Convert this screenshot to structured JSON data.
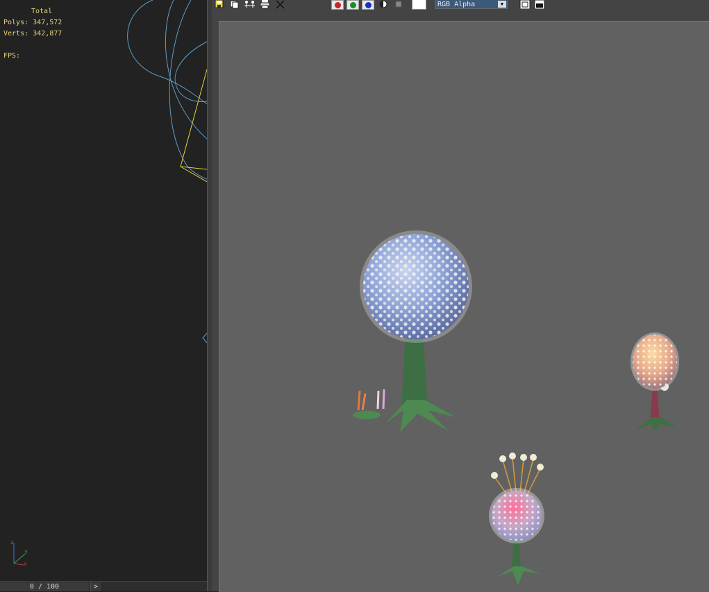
{
  "viewport": {
    "stats": {
      "header": "Total",
      "polys_label": "Polys:",
      "polys_value": "347,572",
      "verts_label": "Verts:",
      "verts_value": "342,877",
      "fps_label": "FPS:"
    },
    "axis": {
      "x_label": "x",
      "y_label": "y",
      "z_label": "z"
    },
    "timeline": {
      "frame_text": "0 / 100",
      "next_icon": "next-frame-arrow"
    }
  },
  "frame_window": {
    "toolbar": {
      "icons": [
        "save-image-icon",
        "copy-image-icon",
        "clone-window-icon",
        "print-image-icon",
        "clear-icon"
      ],
      "channels": {
        "red": "#d42020",
        "green": "#1f8a2a",
        "blue": "#1a2ec8"
      },
      "channel_display": "RGB Alpha",
      "colors": {
        "toolbar_bg": "#444444",
        "render_bg": "#616161",
        "selection": "#3c5a7a"
      }
    }
  }
}
